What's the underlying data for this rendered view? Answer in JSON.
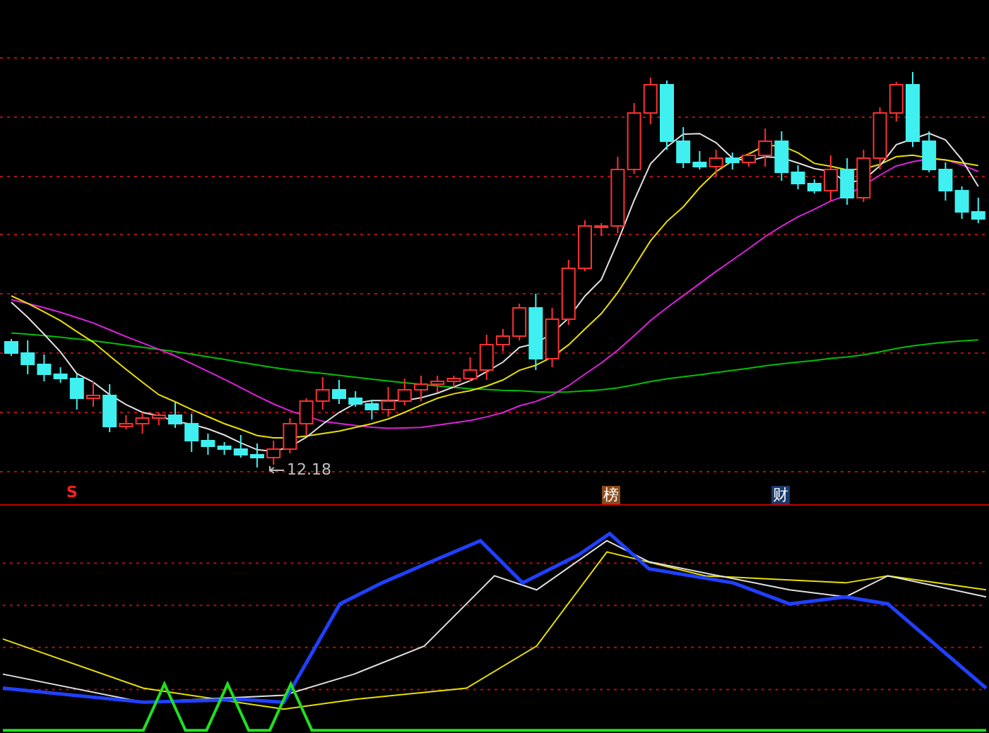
{
  "price_chart": {
    "low_label": "12.18"
  },
  "markers": [
    {
      "label": "S",
      "kind": "signal",
      "color": "#ff2020"
    },
    {
      "label": "榜",
      "kind": "badge",
      "color": "#8a4a1a"
    },
    {
      "label": "财",
      "kind": "badge",
      "color": "#1a3a6a"
    }
  ]
}
